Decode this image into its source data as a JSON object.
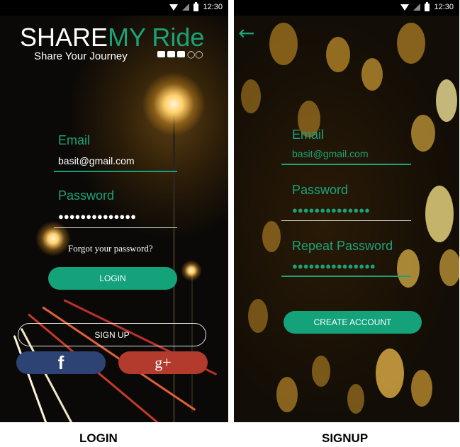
{
  "status_bar": {
    "time": "12:30"
  },
  "login": {
    "logo": {
      "share": "SHARE",
      "my": "MY",
      "ride": "Ride",
      "tagline": "Share Your Journey"
    },
    "email": {
      "label": "Email",
      "value": "basit@gmail.com"
    },
    "password": {
      "label": "Password",
      "value": "●●●●●●●●●●●●●●"
    },
    "forgot_label": "Forgot your password?",
    "login_label": "LOGIN",
    "signup_label": "SIGN UP",
    "facebook_label": "f",
    "google_label": "g+",
    "colors": {
      "accent": "#13a27a",
      "facebook": "#2d4373",
      "google": "#b33b2e"
    }
  },
  "signup": {
    "back_icon": "←",
    "email": {
      "label": "Email",
      "value": "basit@gmail.com"
    },
    "password": {
      "label": "Password",
      "value": "●●●●●●●●●●●●●●"
    },
    "repeat_password": {
      "label": "Repeat Password",
      "value": "●●●●●●●●●●●●●●●"
    },
    "create_label": "CREATE ACCOUNT"
  },
  "captions": {
    "login": "LOGIN",
    "signup": "SIGNUP"
  }
}
